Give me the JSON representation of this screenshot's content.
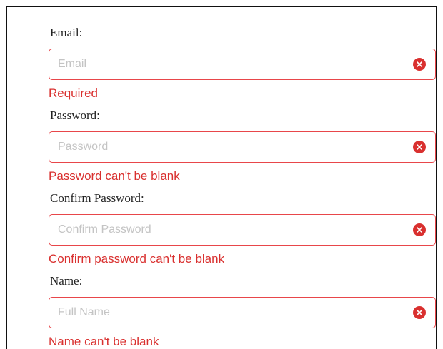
{
  "form": {
    "fields": [
      {
        "label": "Email",
        "colon": ":",
        "placeholder": "Email",
        "value": "",
        "error": "Required"
      },
      {
        "label": "Password",
        "colon": ":",
        "placeholder": "Password",
        "value": "",
        "error": "Password can't be blank"
      },
      {
        "label": "Confirm Password",
        "colon": ":",
        "placeholder": "Confirm Password",
        "value": "",
        "error": "Confirm password can't be blank"
      },
      {
        "label": "Name",
        "colon": ":",
        "placeholder": "Full Name",
        "value": "",
        "error": "Name can't be blank"
      }
    ]
  },
  "icons": {
    "clear": "close-circle-icon"
  },
  "colors": {
    "error": "#d9302f",
    "input_border": "#e8464a",
    "placeholder": "#c4c4c4",
    "label": "#222222"
  }
}
